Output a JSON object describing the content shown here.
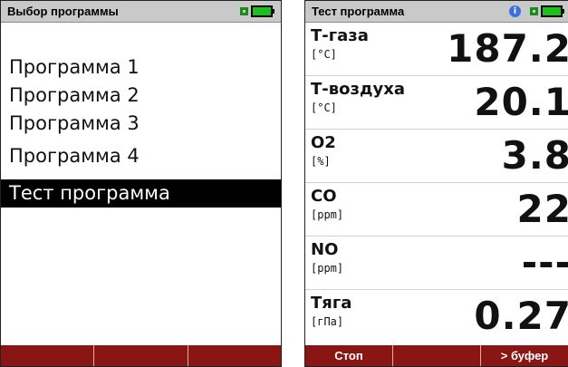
{
  "left_screen": {
    "title": "Выбор программы",
    "items": [
      {
        "label": "Программа 1"
      },
      {
        "label": "Программа 2"
      },
      {
        "label": "Программа 3"
      },
      {
        "label": "Программа 4"
      },
      {
        "label": "Тест программа",
        "selected": true
      }
    ],
    "softkeys": [
      "",
      "",
      ""
    ]
  },
  "right_screen": {
    "title": "Тест программа",
    "measurements": [
      {
        "name": "Т-газа",
        "unit": "[°C]",
        "value": "187.2"
      },
      {
        "name": "Т-воздуха",
        "unit": "[°C]",
        "value": "20.1"
      },
      {
        "name": "O2",
        "unit": "[%]",
        "value": "3.8"
      },
      {
        "name": "CO",
        "unit": "[ppm]",
        "value": "22"
      },
      {
        "name": "NO",
        "unit": "[ppm]",
        "value": "---"
      },
      {
        "name": "Тяга",
        "unit": "[гПа]",
        "value": "0.27"
      }
    ],
    "softkeys": [
      "Стоп",
      "",
      "> буфер"
    ]
  },
  "icons": {
    "battery": "battery-full-icon",
    "plug": "mains-plug-icon",
    "info": "info-icon"
  },
  "colors": {
    "title_bar": "#c9c9c9",
    "softkey_bar": "#8a1515",
    "battery_fill": "#19c219",
    "selection": "#000000"
  }
}
